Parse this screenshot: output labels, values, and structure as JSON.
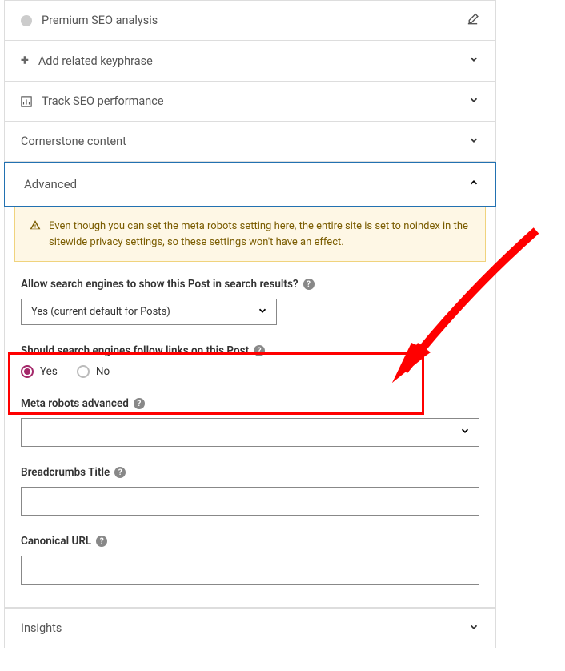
{
  "sections": {
    "premium_seo": "Premium SEO analysis",
    "add_keyphrase": "Add related keyphrase",
    "track_seo": "Track SEO performance",
    "cornerstone": "Cornerstone content",
    "advanced": "Advanced",
    "insights": "Insights"
  },
  "advanced": {
    "warning": "Even though you can set the meta robots setting here, the entire site is set to noindex in the sitewide privacy settings, so these settings won't have an effect.",
    "allow_search": {
      "label": "Allow search engines to show this Post in search results?",
      "value": "Yes (current default for Posts)"
    },
    "follow_links": {
      "label": "Should search engines follow links on this Post",
      "options": {
        "yes": "Yes",
        "no": "No"
      },
      "selected": "yes"
    },
    "meta_robots": {
      "label": "Meta robots advanced",
      "value": ""
    },
    "breadcrumbs": {
      "label": "Breadcrumbs Title",
      "value": ""
    },
    "canonical": {
      "label": "Canonical URL",
      "value": ""
    }
  }
}
